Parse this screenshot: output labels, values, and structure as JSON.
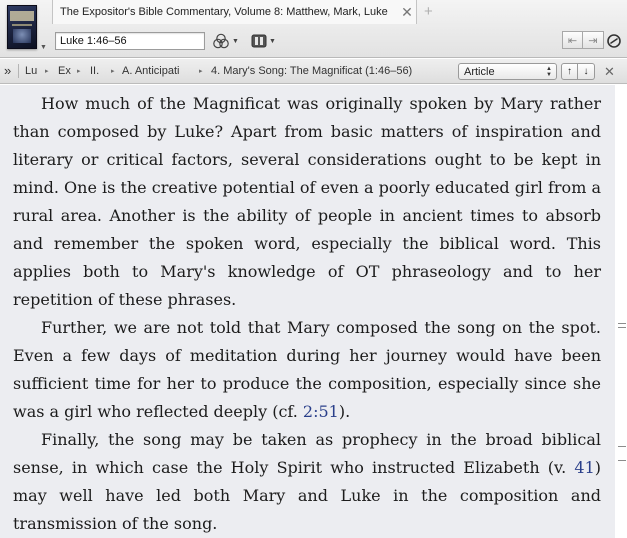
{
  "tab": {
    "title": "The Expositor's Bible Commentary, Volume 8: Matthew, Mark, Luke",
    "close_glyph": "✕",
    "new_tab_glyph": "+"
  },
  "toolbar": {
    "reference_value": "Luke 1:46–56",
    "cover_icon": "book-cover-thumbnail",
    "visual_filters_icon": "overlapping-circles-icon",
    "layout_icon": "panel-columns-icon",
    "back_glyph": "⇤",
    "forward_glyph": "⇥",
    "sync_icon": "chain-link-icon"
  },
  "breadcrumb": {
    "expand_glyph": "»",
    "items": [
      "Lu",
      "Ex",
      "II.",
      "A. Anticipati",
      "4. Mary's Song: The Magnificat (1:46–56)"
    ],
    "separator_glyph": "▸",
    "view_select": "Article",
    "up_glyph": "↑",
    "down_glyph": "↓",
    "close_glyph": "✕"
  },
  "content": {
    "p1": "How much of the Magnificat was originally spoken by Mary rather than composed by Luke? Apart from basic matters of inspiration and literary or critical factors, several considerations ought to be kept in mind. One is the creative potential of even a poorly educated girl from a rural area. Another is the ability of people in ancient times to absorb and remember the spoken word, especially the biblical word. This applies both to Mary's knowledge of OT phraseology and to her repetition of these phrases.",
    "p2_before": "Further, we are not told that Mary composed the song on the spot. Even a few days of meditation during her journey would have been sufficient time for her to produce the composition, especially since she was a girl who reflected deeply (cf. ",
    "p2_ref": "2:51",
    "p2_after": ").",
    "p3_before": "Finally, the song may be taken as prophecy in the broad biblical sense, in which case the Holy Spirit who instructed Elizabeth (v. ",
    "p3_ref": "41",
    "p3_after": ") may well have led both Mary and Luke in the composition and transmission of the song."
  },
  "colors": {
    "reading_background": "#ecedf1",
    "reference_link": "#2a3f8a"
  }
}
